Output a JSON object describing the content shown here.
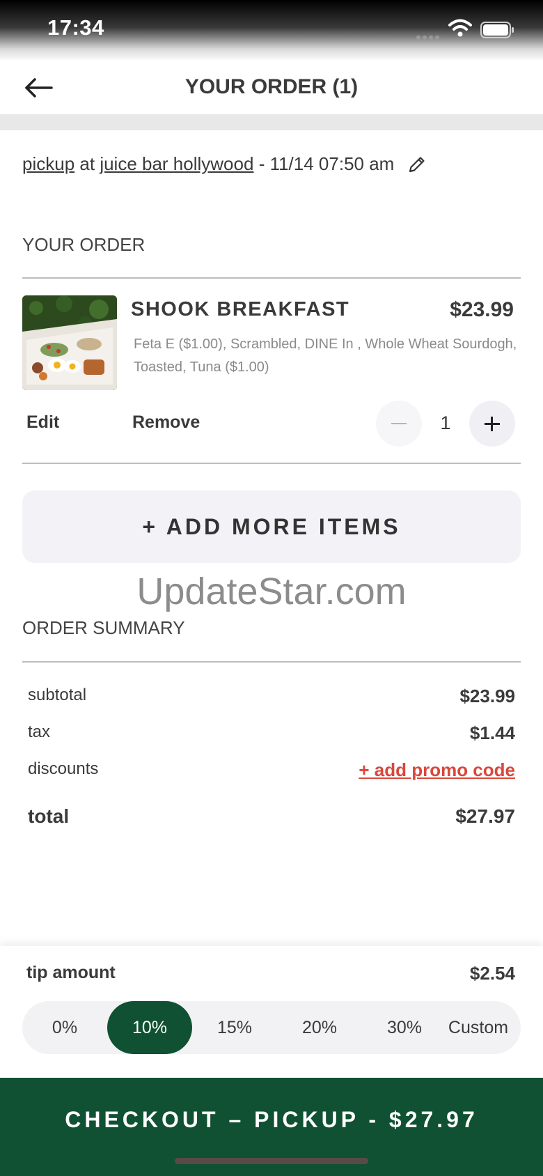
{
  "status": {
    "time": "17:34"
  },
  "header": {
    "title": "YOUR ORDER (1)"
  },
  "pickup": {
    "mode": "pickup",
    "at": "at",
    "location": "juice bar hollywood",
    "datetime": "- 11/14 07:50 am"
  },
  "order": {
    "section_label": "YOUR ORDER",
    "item": {
      "name": "SHOOK BREAKFAST",
      "price": "$23.99",
      "modifiers": "Feta E ($1.00), Scrambled, DINE In , Whole Wheat Sourdogh, Toasted, Tuna ($1.00)",
      "edit_label": "Edit",
      "remove_label": "Remove",
      "quantity": "1"
    },
    "add_more_label": "+ ADD MORE ITEMS"
  },
  "watermark": "UpdateStar.com",
  "summary": {
    "section_label": "ORDER SUMMARY",
    "subtotal_label": "subtotal",
    "subtotal_value": "$23.99",
    "tax_label": "tax",
    "tax_value": "$1.44",
    "discounts_label": "discounts",
    "promo_label": "+ add promo code",
    "total_label": "total",
    "total_value": "$27.97"
  },
  "tip": {
    "label": "tip amount",
    "amount": "$2.54",
    "options": [
      "0%",
      "10%",
      "15%",
      "20%",
      "30%",
      "Custom"
    ],
    "selected": "10%"
  },
  "checkout": {
    "label": "CHECKOUT – PICKUP - $27.97"
  },
  "colors": {
    "brand_green": "#0f5132",
    "promo_red": "#d9473b"
  }
}
